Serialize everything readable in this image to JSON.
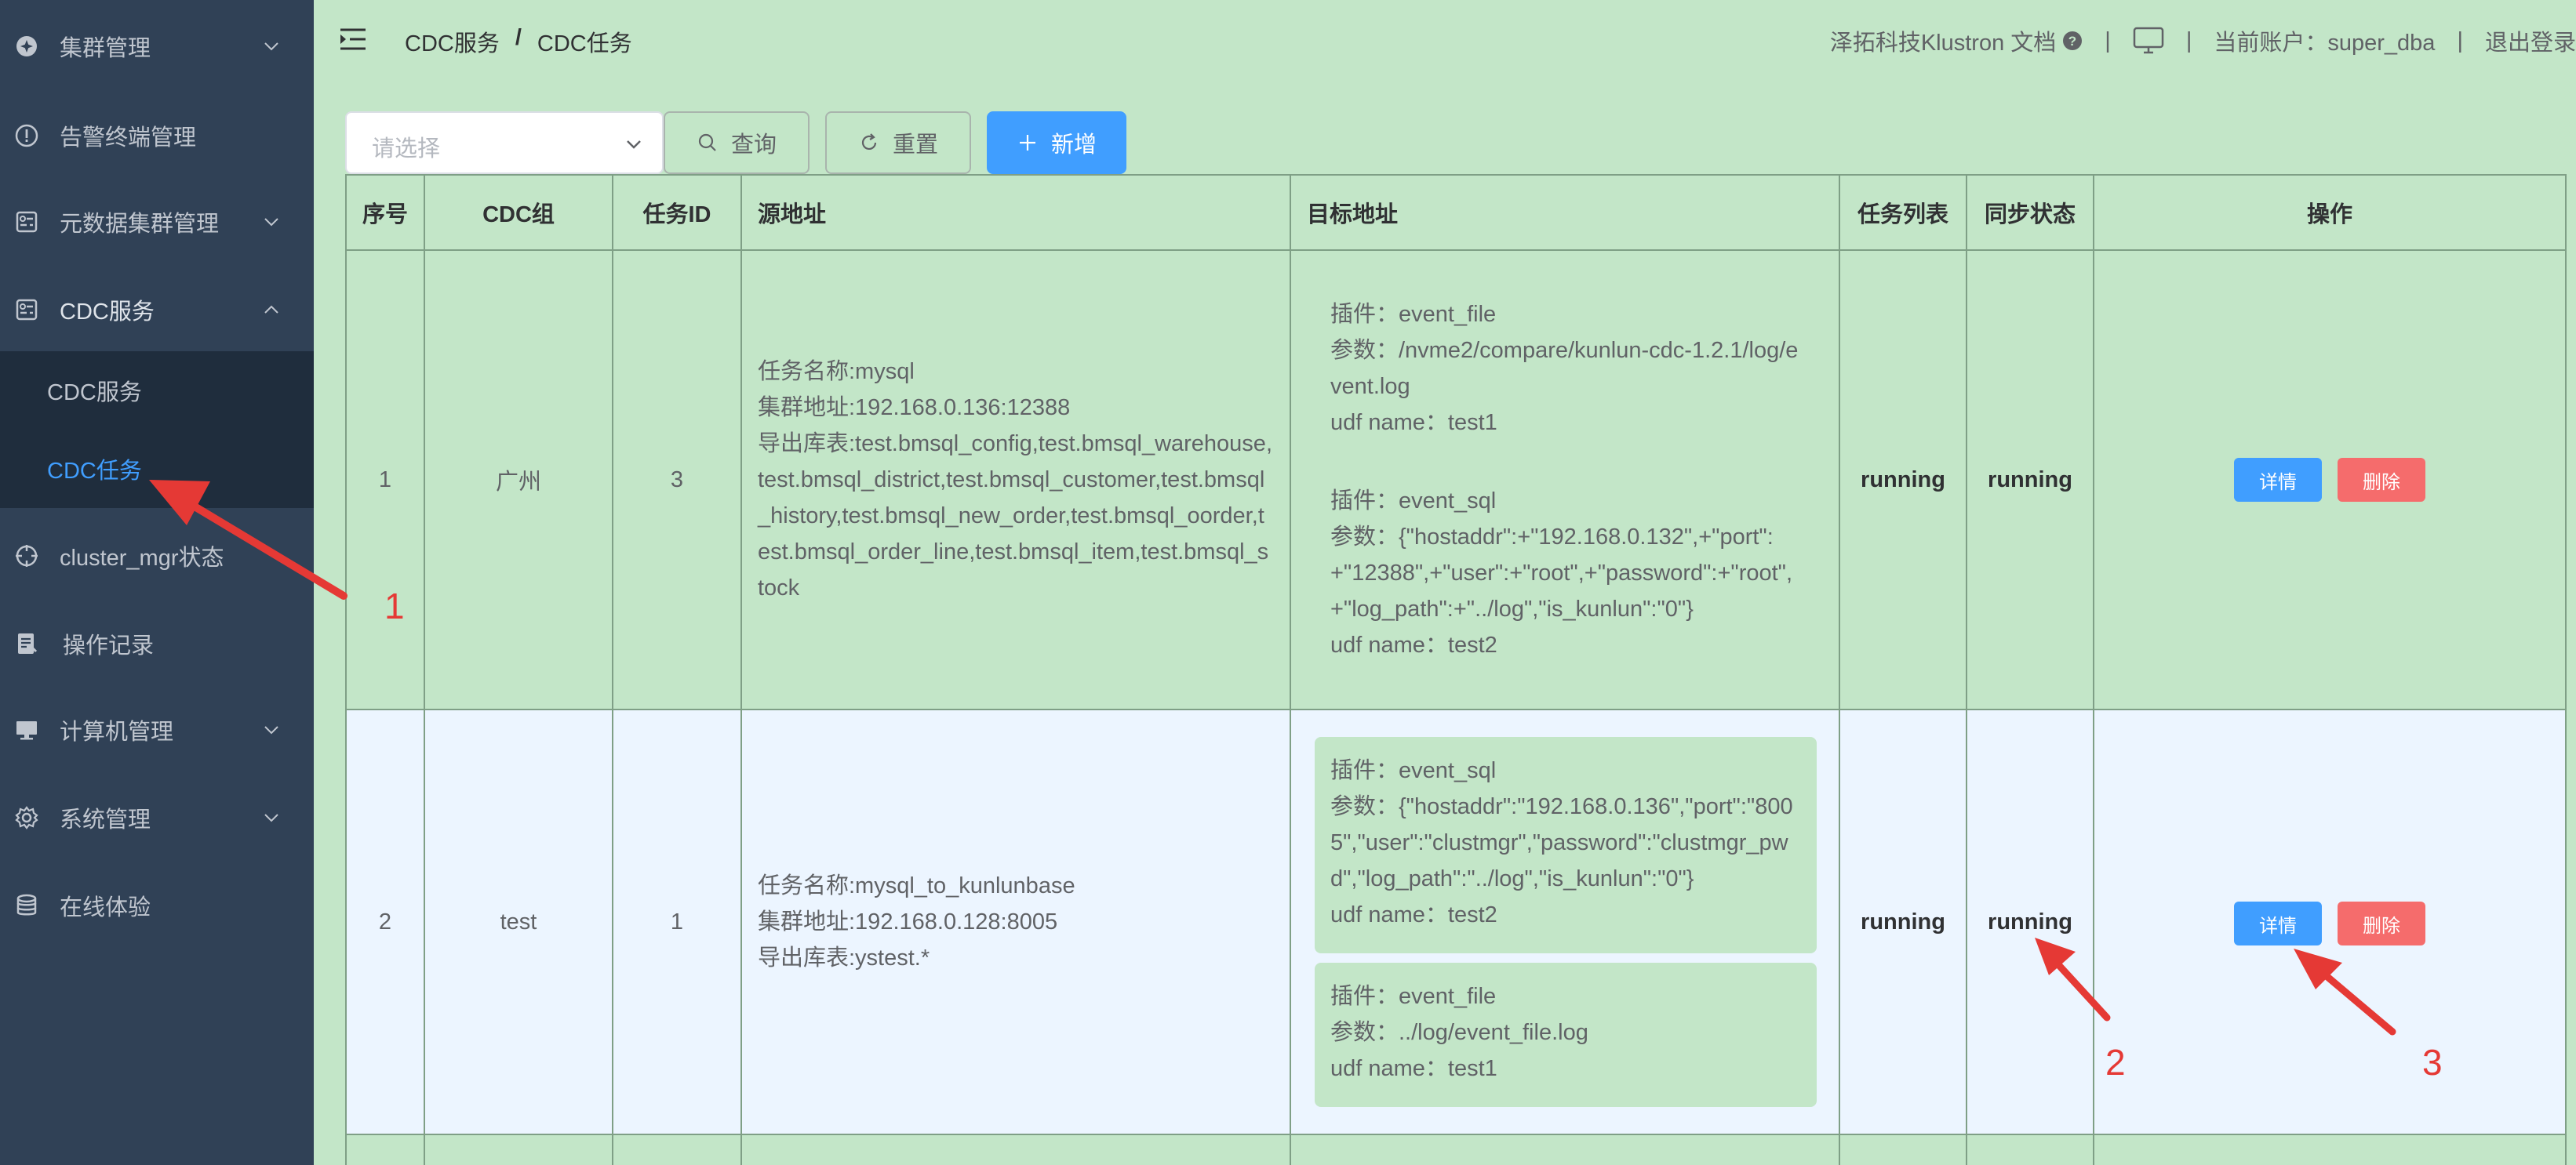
{
  "sidebar": {
    "items": [
      {
        "label": "集群管理",
        "icon": "cluster-icon",
        "chevron": "down"
      },
      {
        "label": "告警终端管理",
        "icon": "alert-icon",
        "chevron": ""
      },
      {
        "label": "元数据集群管理",
        "icon": "metadata-icon",
        "chevron": "down"
      },
      {
        "label": "CDC服务",
        "icon": "cdc-icon",
        "chevron": "up"
      },
      {
        "label": "cluster_mgr状态",
        "icon": "crosshair-icon",
        "chevron": ""
      },
      {
        "label": "操作记录",
        "icon": "record-icon",
        "chevron": ""
      },
      {
        "label": "计算机管理",
        "icon": "computer-icon",
        "chevron": "down"
      },
      {
        "label": "系统管理",
        "icon": "gear-icon",
        "chevron": "down"
      },
      {
        "label": "在线体验",
        "icon": "database-icon",
        "chevron": ""
      }
    ],
    "submenu": [
      {
        "label": "CDC服务",
        "active": false
      },
      {
        "label": "CDC任务",
        "active": true
      }
    ],
    "active_color": "#409eff"
  },
  "header": {
    "breadcrumb": [
      "CDC服务",
      "CDC任务"
    ],
    "breadcrumb_sep": "/",
    "docs_link": "泽拓科技Klustron 文档",
    "account_label": "当前账户：super_dba",
    "logout": "退出登录",
    "pipe": "|"
  },
  "toolbar": {
    "select_placeholder": "请选择",
    "query_label": "查询",
    "reset_label": "重置",
    "add_label": "新增"
  },
  "table": {
    "headers": [
      "序号",
      "CDC组",
      "任务ID",
      "源地址",
      "目标地址",
      "任务列表",
      "同步状态",
      "操作"
    ],
    "rows": [
      {
        "index": "1",
        "group": "广州",
        "task_id": "3",
        "source": [
          "任务名称:mysql",
          "集群地址:192.168.0.136:12388",
          "导出库表:test.bmsql_config,test.bmsql_warehouse,test.bmsql_district,test.bmsql_customer,test.bmsql_history,test.bmsql_new_order,test.bmsql_oorder,test.bmsql_order_line,test.bmsql_item,test.bmsql_stock"
        ],
        "targets": [
          {
            "plugin": "插件：event_file",
            "params": "参数：/nvme2/compare/kunlun-cdc-1.2.1/log/event.log",
            "udf": "udf name：test1"
          },
          {
            "plugin": "插件：event_sql",
            "params": "参数：{\"hostaddr\":+\"192.168.0.132\",+\"port\":+\"12388\",+\"user\":+\"root\",+\"password\":+\"root\",+\"log_path\":+\"../log\",\"is_kunlun\":\"0\"}",
            "udf": "udf name：test2"
          }
        ],
        "task_list": "running",
        "sync_status": "running"
      },
      {
        "index": "2",
        "group": "test",
        "task_id": "1",
        "source": [
          "任务名称:mysql_to_kunlunbase",
          "集群地址:192.168.0.128:8005",
          "导出库表:ystest.*"
        ],
        "targets": [
          {
            "plugin": "插件：event_sql",
            "params": "参数：{\"hostaddr\":\"192.168.0.136\",\"port\":\"8005\",\"user\":\"clustmgr\",\"password\":\"clustmgr_pwd\",\"log_path\":\"../log\",\"is_kunlun\":\"0\"}",
            "udf": "udf name：test2"
          },
          {
            "plugin": "插件：event_file",
            "params": "参数：../log/event_file.log",
            "udf": "udf name：test1"
          }
        ],
        "task_list": "running",
        "sync_status": "running"
      }
    ],
    "detail_label": "详情",
    "delete_label": "删除"
  },
  "annotations": [
    "1",
    "2",
    "3"
  ],
  "colors": {
    "sidebar_bg": "#304156",
    "page_bg": "#c3e6c8",
    "primary": "#409eff",
    "danger": "#f56c6c",
    "row_highlight": "#ecf5ff",
    "annotation": "#e53935"
  }
}
